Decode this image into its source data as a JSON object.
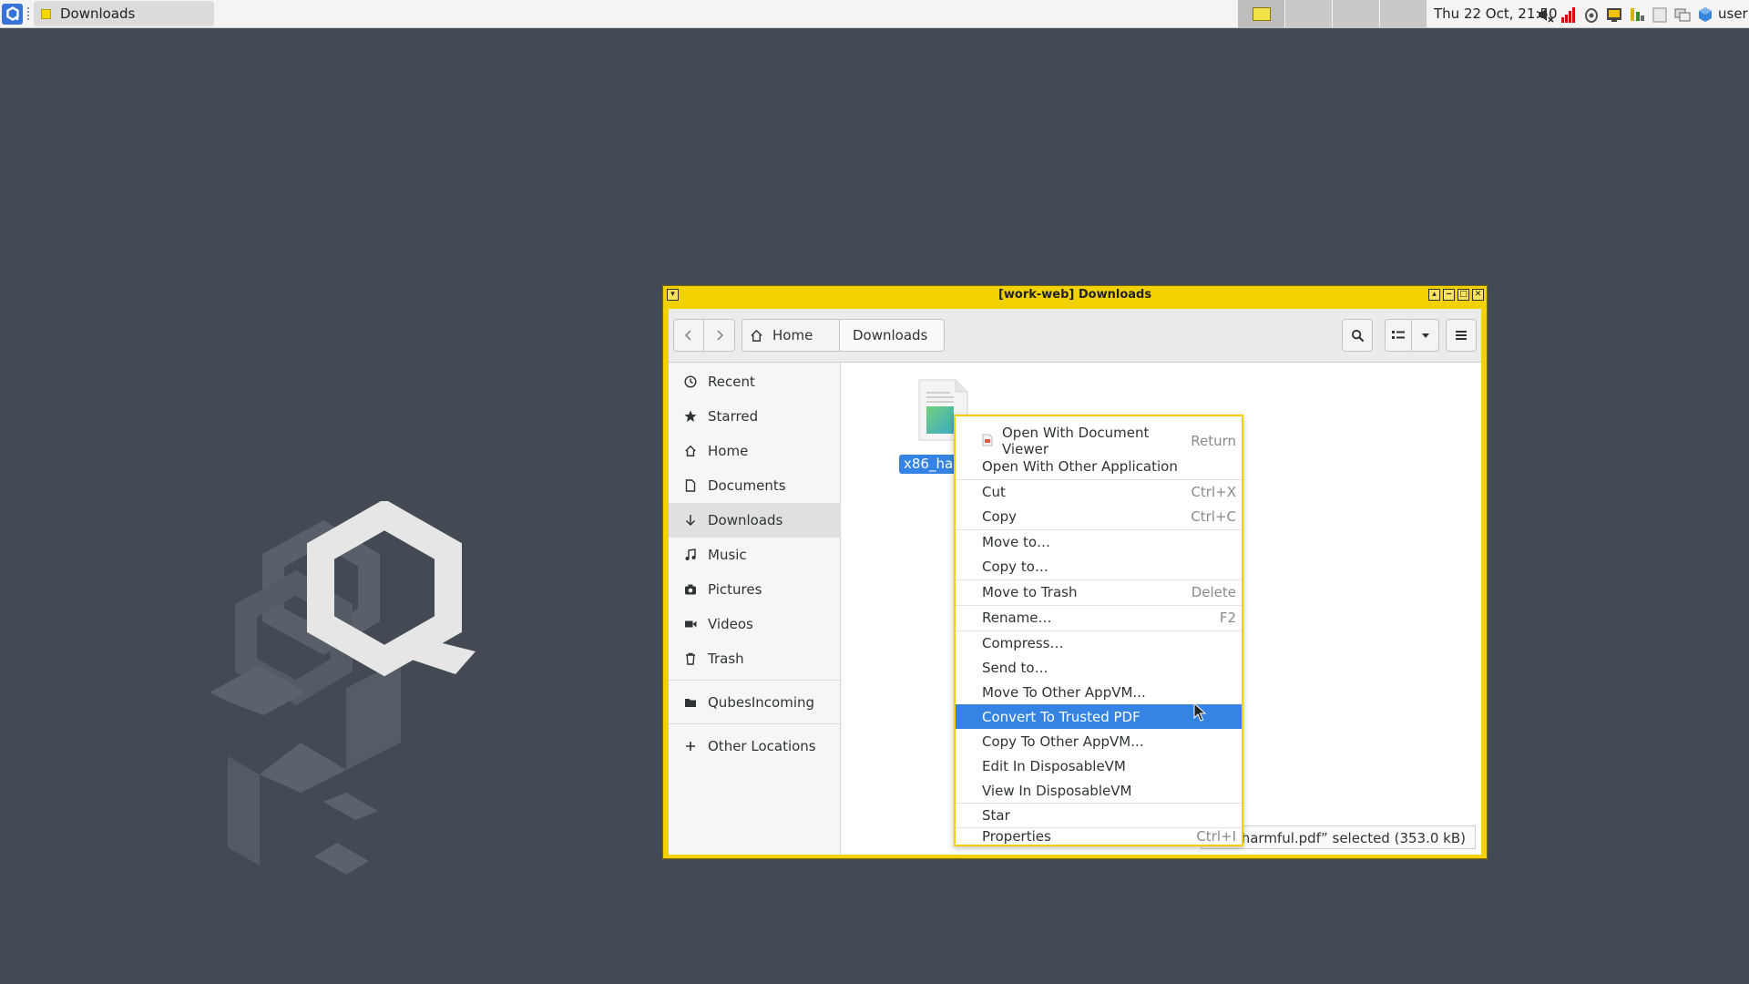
{
  "top_panel": {
    "task_title": "Downloads",
    "clock": "Thu 22 Oct, 21:50",
    "user": "user"
  },
  "window": {
    "title": "[work-web] Downloads",
    "frame_color": "#f2d100"
  },
  "headerbar": {
    "path_home": "Home",
    "path_current": "Downloads"
  },
  "sidebar": {
    "items": [
      {
        "label": "Recent",
        "icon": "clock-icon"
      },
      {
        "label": "Starred",
        "icon": "star-icon"
      },
      {
        "label": "Home",
        "icon": "home-icon"
      },
      {
        "label": "Documents",
        "icon": "document-icon"
      },
      {
        "label": "Downloads",
        "icon": "download-icon",
        "active": true
      },
      {
        "label": "Music",
        "icon": "music-icon"
      },
      {
        "label": "Pictures",
        "icon": "camera-icon"
      },
      {
        "label": "Videos",
        "icon": "video-icon"
      },
      {
        "label": "Trash",
        "icon": "trash-icon"
      },
      {
        "label": "QubesIncoming",
        "icon": "folder-icon"
      },
      {
        "label": "Other Locations",
        "icon": "plus-icon"
      }
    ]
  },
  "content": {
    "file_name": "x86_harmful.pdf",
    "status": "x86_harmful.pdf” selected (353.0 kB)"
  },
  "context_menu": {
    "items": [
      {
        "label": "Open With Document Viewer",
        "accel": "Return"
      },
      {
        "label": "Open With Other Application",
        "accel": ""
      },
      {
        "label": "Cut",
        "accel": "Ctrl+X"
      },
      {
        "label": "Copy",
        "accel": "Ctrl+C"
      },
      {
        "label": "Move to…",
        "accel": ""
      },
      {
        "label": "Copy to…",
        "accel": ""
      },
      {
        "label": "Move to Trash",
        "accel": "Delete"
      },
      {
        "label": "Rename…",
        "accel": "F2"
      },
      {
        "label": "Compress…",
        "accel": ""
      },
      {
        "label": "Send to…",
        "accel": ""
      },
      {
        "label": "Move To Other AppVM...",
        "accel": ""
      },
      {
        "label": "Convert To Trusted PDF",
        "accel": "",
        "highlighted": true
      },
      {
        "label": "Copy To Other AppVM...",
        "accel": ""
      },
      {
        "label": "Edit In DisposableVM",
        "accel": ""
      },
      {
        "label": "View In DisposableVM",
        "accel": ""
      },
      {
        "label": "Star",
        "accel": ""
      },
      {
        "label": "Properties",
        "accel": "Ctrl+I"
      }
    ],
    "highlight_color": "#3584e4"
  }
}
